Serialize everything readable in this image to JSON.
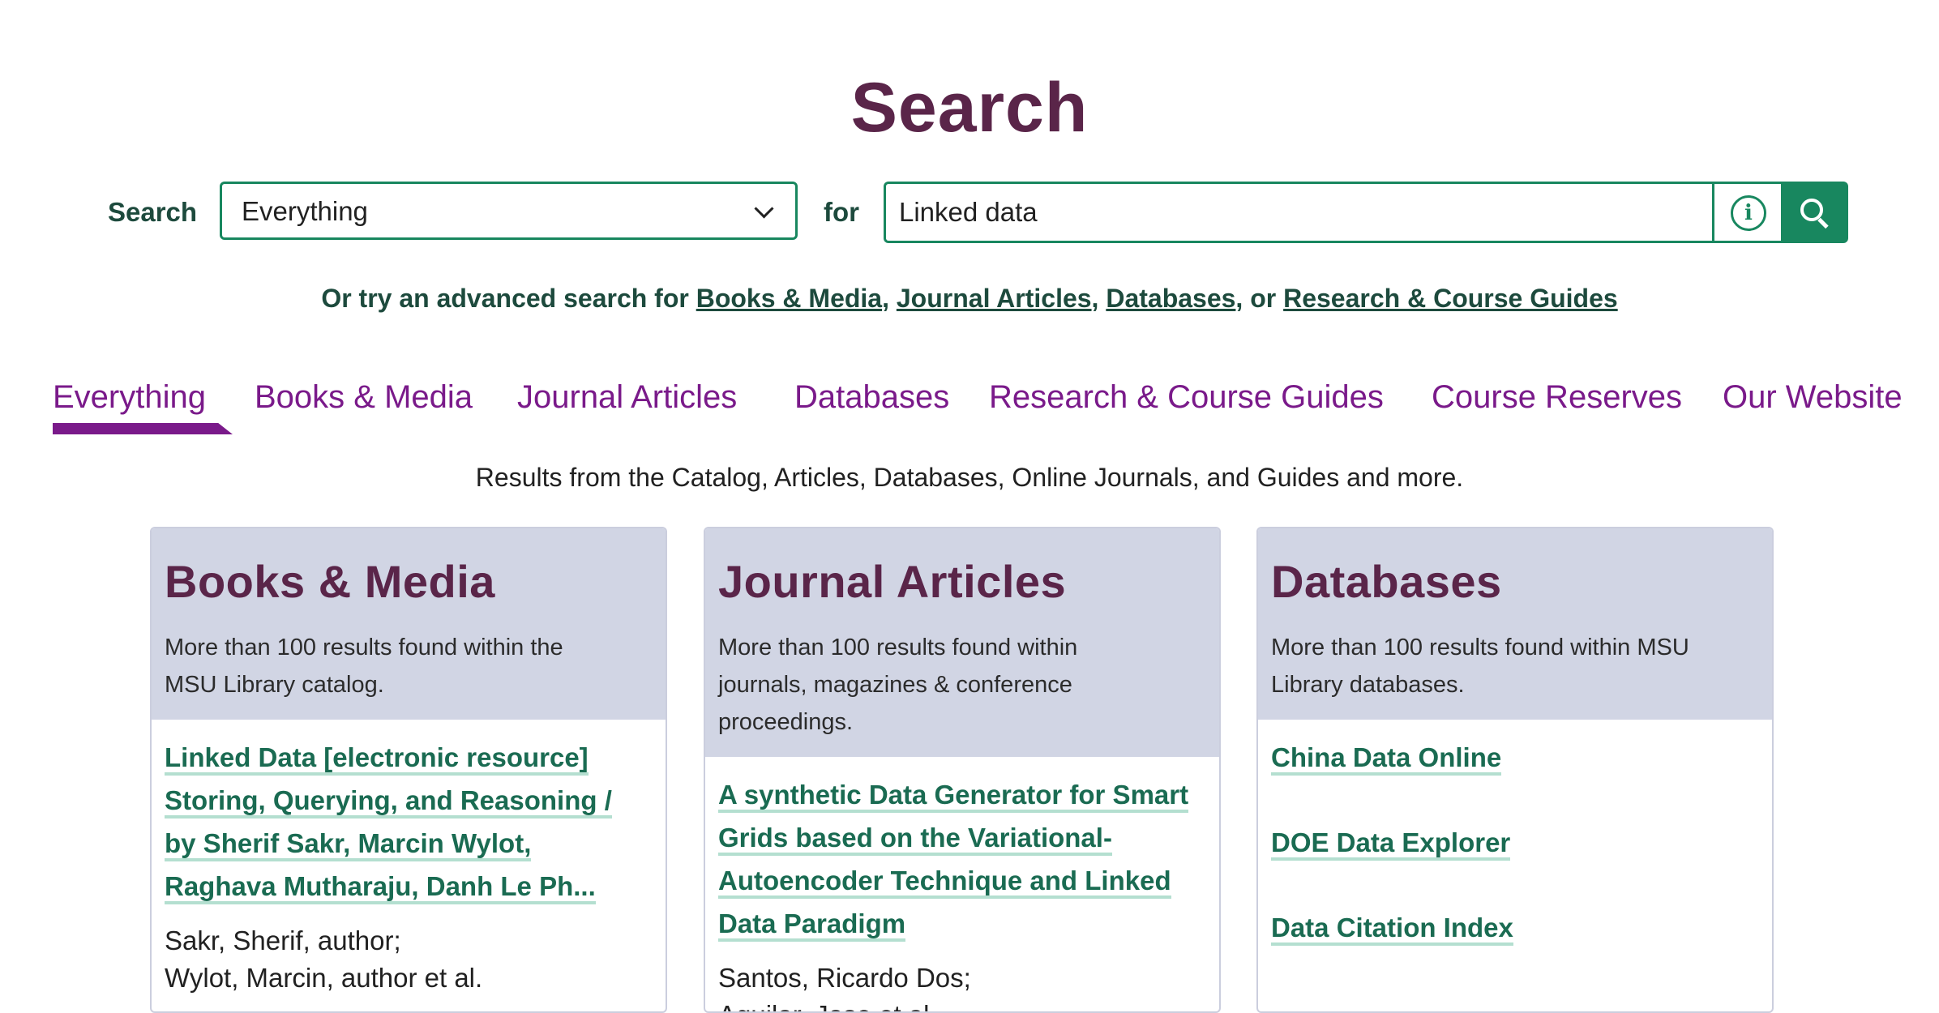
{
  "title": "Search",
  "search": {
    "label": "Search",
    "scope_value": "Everything",
    "for_label": "for",
    "query_value": "Linked data"
  },
  "advanced": {
    "prefix": "Or try an advanced search for ",
    "links": [
      "Books & Media",
      "Journal Articles",
      "Databases",
      "Research & Course Guides"
    ],
    "sep1": ", ",
    "sep2": ", ",
    "sep3": ", or "
  },
  "tabs": [
    {
      "label": "Everything",
      "active": true
    },
    {
      "label": "Books & Media",
      "active": false
    },
    {
      "label": "Journal Articles",
      "active": false
    },
    {
      "label": "Databases",
      "active": false
    },
    {
      "label": "Research & Course Guides",
      "active": false
    },
    {
      "label": "Course Reserves",
      "active": false
    },
    {
      "label": "Our Website",
      "active": false
    }
  ],
  "results_note": "Results from the Catalog, Articles, Databases, Online Journals, and Guides and more.",
  "cards": [
    {
      "title": "Books & Media",
      "desc_lines": [
        "More than 100 results found within the",
        "MSU Library catalog."
      ],
      "result": {
        "link_lines": [
          "Linked Data [electronic resource]",
          "Storing, Querying, and Reasoning /",
          "by Sherif Sakr, Marcin Wylot,",
          "Raghava Mutharaju, Danh Le Ph..."
        ],
        "meta_lines": [
          "Sakr, Sherif, author;",
          "Wylot, Marcin, author et al."
        ]
      }
    },
    {
      "title": "Journal Articles",
      "desc_lines": [
        "More than 100 results found within",
        "journals, magazines & conference",
        "proceedings."
      ],
      "result": {
        "link_lines": [
          "A synthetic Data Generator for Smart",
          "Grids based on the Variational-",
          "Autoencoder Technique and Linked",
          "Data Paradigm"
        ],
        "meta_lines": [
          "Santos, Ricardo Dos;",
          "Aguilar, Jose et al."
        ]
      }
    },
    {
      "title": "Databases",
      "desc_lines": [
        "More than 100 results found within MSU",
        "Library databases."
      ],
      "items": [
        "China Data Online",
        "DOE Data Explorer",
        "Data Citation Index"
      ]
    }
  ],
  "icons": {
    "scope_chevron": "chevron-down-icon",
    "info": "info-icon",
    "search": "search-icon"
  },
  "colors": {
    "title": "#5a2549",
    "green": "#18875f",
    "tab_purple": "#7a1a8a",
    "card_head": "#d1d5e4",
    "link_green": "#1a6b52"
  }
}
